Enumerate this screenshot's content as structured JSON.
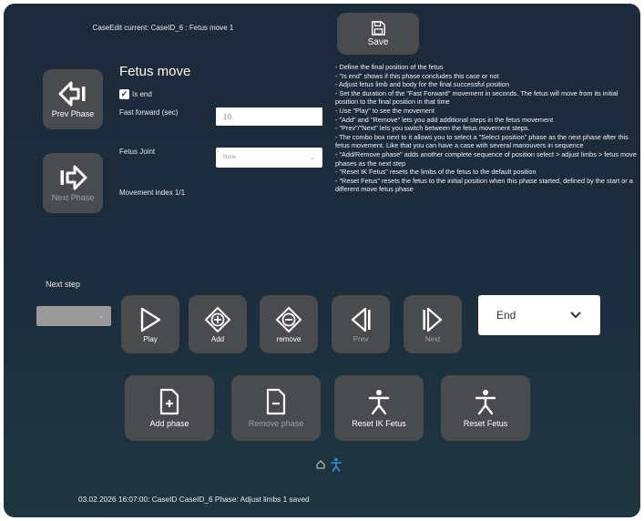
{
  "header": {
    "case_title": "CaseEdit current: CaseID_6 : Fetus move 1",
    "save_label": "Save"
  },
  "nav": {
    "prev_phase_label": "Prev Phase",
    "next_phase_label": "Next Phase"
  },
  "fetus_move": {
    "title": "Fetus move",
    "is_end_label": "Is end",
    "is_end_checked": true,
    "fast_forward_label": "Fast forward (sec)",
    "fast_forward_value": "10",
    "fetus_joint_label": "Fetus Joint",
    "fetus_joint_value": "None",
    "movement_index": "Movement index 1/1"
  },
  "help_lines": [
    "- Define the final position of the fetus",
    "        - \"Is end\" shows if this phase concludes this case or not",
    "        - Adjust fetus limb and body for the final successful position",
    "        - Set the duration of the \"Fast Forward\" movement in seconds. The fetus will move from its initial position to the final position in that time",
    "        - Use \"Play\" to see the movement",
    "        - \"Add\" and \"Remove\" lets you add additional steps in the fetus movement",
    "        - \"Prev\"/\"Next\" lets you switch between the fetus movement steps.",
    "        - The combo box next to it allows you to select a \"Select position\" phase as the next phase after this fetus movement. Like that you can have a case with several manouvers in sequence",
    "        - \"Add/Remove phase\" adds another complete sequence of position select > adjust limbs > fetus move phases as the next step",
    "        - \"Reset IK Fetus\" resets the limbs of the fetus to the default position",
    "        - \"Reset Fetus\" resets the fetus to the initial position when this phase started, defined by the start or a different move fetus phase"
  ],
  "next_step": {
    "label": "Next step",
    "value": ""
  },
  "controls": {
    "play": "Play",
    "add": "Add",
    "remove": "remove",
    "prev": "Prev",
    "next": "Next",
    "end_select_value": "End"
  },
  "phase_buttons": {
    "add_phase": "Add phase",
    "remove_phase": "Remove phase",
    "reset_ik": "Reset IK Fetus",
    "reset_fetus": "Reset Fetus"
  },
  "icons": {
    "home": "home-icon",
    "figure": "figure-icon"
  },
  "colors": {
    "button_bg": "#4a4b4e",
    "panel_bg": "#1d2a3c",
    "accent_blue": "#2f8fe0"
  },
  "status": "03.02.2026 16:07:00: CaseID CaseID_6 Phase: Adjust limbs 1 saved"
}
